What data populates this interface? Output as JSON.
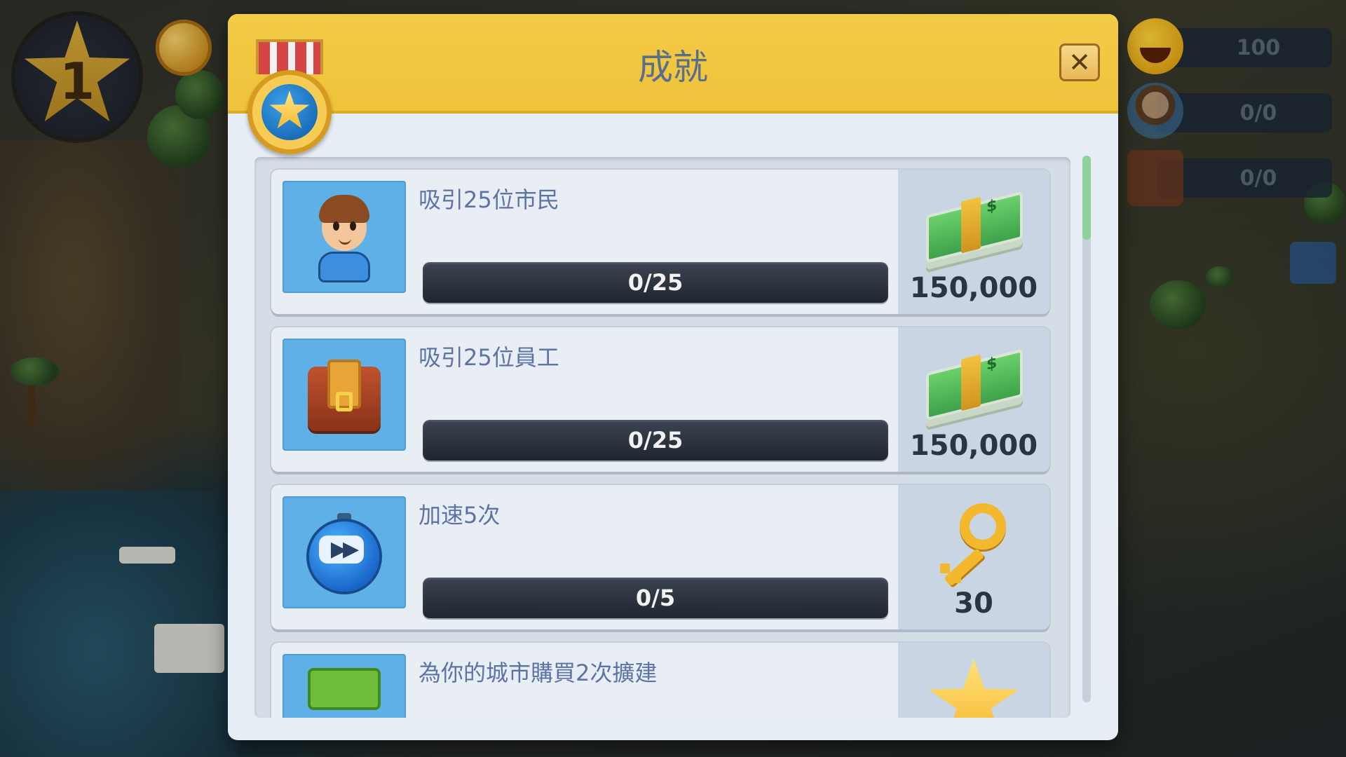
{
  "hud": {
    "level": "1",
    "stats": [
      "100",
      "0/0",
      "0/0"
    ]
  },
  "dialog": {
    "title": "成就",
    "close_icon": "✕"
  },
  "achievements": [
    {
      "title": "吸引25位市民",
      "progress": "0/25",
      "progress_fraction": 0,
      "reward": "150,000",
      "icon": "person-icon",
      "reward_icon": "money-icon"
    },
    {
      "title": "吸引25位員工",
      "progress": "0/25",
      "progress_fraction": 0,
      "reward": "150,000",
      "icon": "bag-icon",
      "reward_icon": "money-icon"
    },
    {
      "title": "加速5次",
      "progress": "0/5",
      "progress_fraction": 0,
      "reward": "30",
      "icon": "timer-icon",
      "reward_icon": "key-icon"
    },
    {
      "title": "為你的城市購買2次擴建",
      "progress": "",
      "reward": "",
      "icon": "expansion-icon",
      "reward_icon": "star-icon"
    }
  ],
  "colors": {
    "header": "#f3cb47",
    "title": "#5a6f8e",
    "card": "#e9eef5",
    "icon_box": "#5fb0e6",
    "progress_track": "#2a323d",
    "reward_panel": "#c9d5e3"
  },
  "money_glyph": "$"
}
